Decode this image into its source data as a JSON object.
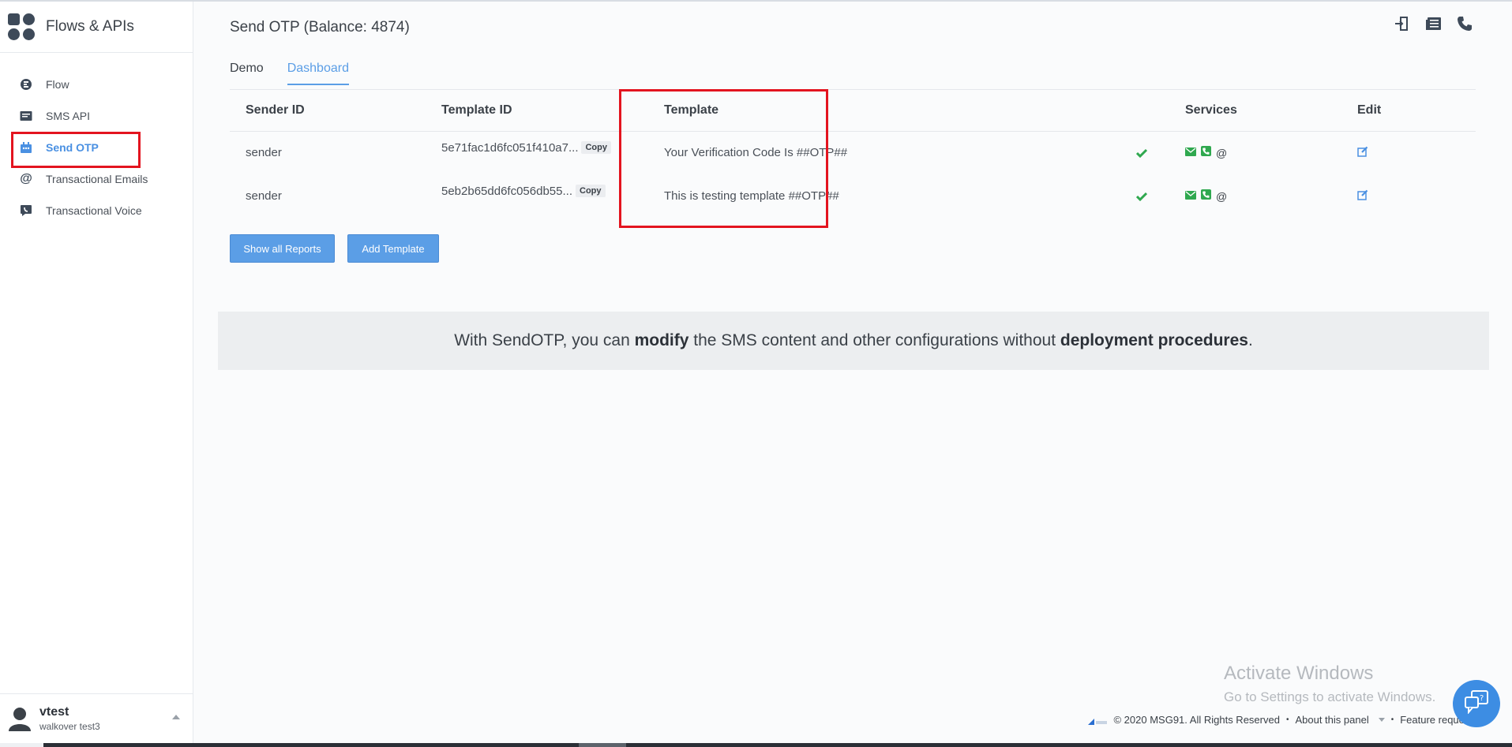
{
  "sidebar": {
    "title": "Flows & APIs",
    "items": [
      {
        "label": "Flow",
        "icon": "flow-icon"
      },
      {
        "label": "SMS API",
        "icon": "sms-api-icon"
      },
      {
        "label": "Send OTP",
        "icon": "send-otp-icon"
      },
      {
        "label": "Transactional Emails",
        "icon": "at-icon"
      },
      {
        "label": "Transactional Voice",
        "icon": "voice-icon"
      }
    ],
    "user": {
      "name": "vtest",
      "sub": "walkover test3"
    }
  },
  "header": {
    "title": "Send OTP (Balance: 4874)",
    "icons": [
      "login-icon",
      "docs-icon",
      "phone-icon"
    ]
  },
  "tabs": [
    {
      "label": "Demo",
      "active": false
    },
    {
      "label": "Dashboard",
      "active": true
    }
  ],
  "table": {
    "columns": [
      "Sender ID",
      "Template ID",
      "Template",
      "Services",
      "Edit"
    ],
    "copy_label": "Copy",
    "rows": [
      {
        "sender": "sender",
        "template_id": "5e71fac1d6fc051f410a7...",
        "template": "Your Verification Code Is ##OTP##"
      },
      {
        "sender": "sender",
        "template_id": "5eb2b65dd6fc056db55...",
        "template": "This is testing template ##OTP##"
      }
    ],
    "services_text": "@"
  },
  "buttons": {
    "show_reports": "Show all Reports",
    "add_template": "Add Template"
  },
  "banner": {
    "part1": "With SendOTP, you can ",
    "bold1": "modify",
    "part2": " the SMS content and other configurations without ",
    "bold2": "deployment procedures",
    "part3": "."
  },
  "watermark": {
    "line1": "Activate Windows",
    "line2": "Go to Settings to activate Windows."
  },
  "footer": {
    "copyright": "© 2020 MSG91. All Rights Reserved",
    "about": "About this panel",
    "feature": "Feature request"
  },
  "colors": {
    "accent": "#5b9ee6",
    "highlight": "#e3141f",
    "success": "#2fa84f",
    "fab": "#3d8de3"
  }
}
